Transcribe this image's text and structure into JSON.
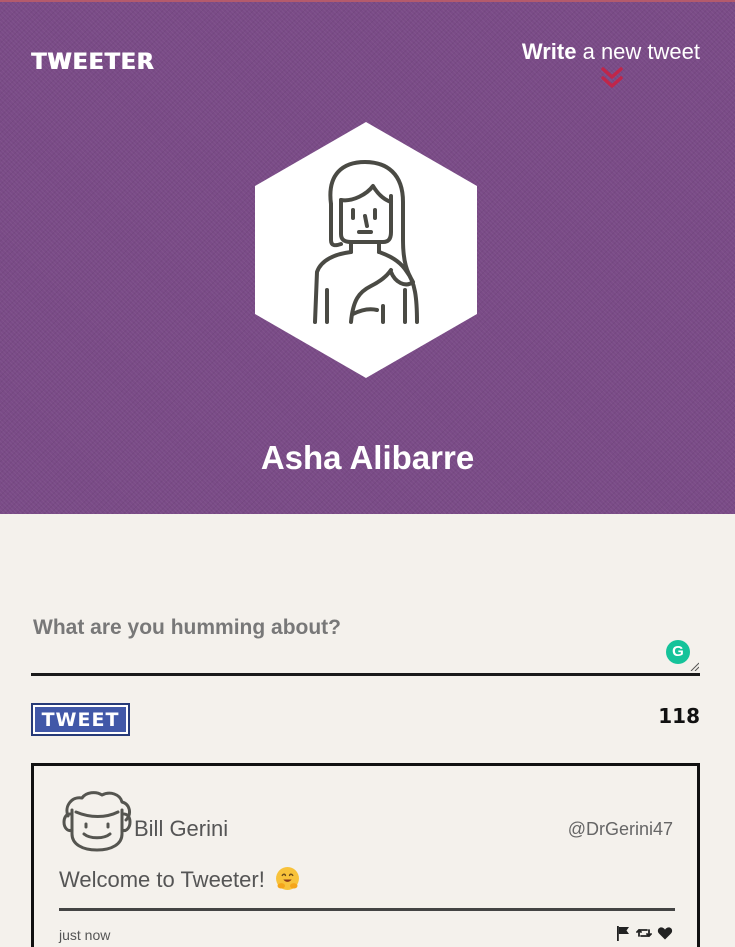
{
  "header": {
    "logo": "TWEETER",
    "compose_strong": "Write",
    "compose_rest": " a new tweet",
    "user_name": "Asha Alibarre"
  },
  "composer": {
    "placeholder": "What are you humming about?",
    "value": "",
    "grammarly_letter": "G",
    "tweet_button_label": "TWEET",
    "char_count": "118"
  },
  "tweet": {
    "author": "Bill Gerini",
    "handle": "@DrGerini47",
    "text": "Welcome to Tweeter!",
    "time": "just now",
    "actions": [
      "flag-icon",
      "retweet-icon",
      "heart-icon"
    ]
  },
  "colors": {
    "header_bg": "#7a4b87",
    "accent_arrow": "#c0264a",
    "tweet_button": "#4158a8",
    "page_bg": "#f4f1ec"
  }
}
